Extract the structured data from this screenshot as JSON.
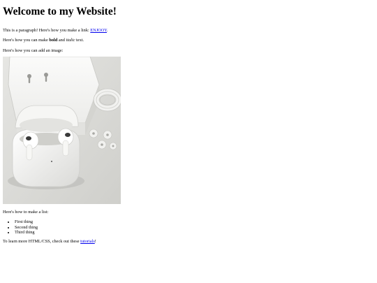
{
  "heading": "Welcome to my Website!",
  "paragraph1": {
    "text": "This is a paragraph! Here's how you make a link: ",
    "link_text": "ENJOOY",
    "suffix": "."
  },
  "paragraph2": {
    "prefix": "Here's how you can make ",
    "bold_text": "bold",
    "middle": " and ",
    "italic_text": "italic",
    "suffix": " text."
  },
  "paragraph3": "Here's how you can add an image:",
  "image": {
    "subject": "white wireless earbuds in open charging case with box, cable and ear tips",
    "colors": {
      "background": "#dcdcd9",
      "case": "#f4f4f2",
      "shadow": "#b9b9b5"
    }
  },
  "paragraph4": "Here's how to make a list:",
  "list_items": [
    "First thing",
    "Second thing",
    "Third thing"
  ],
  "paragraph5": {
    "prefix": "To learn more HTML/CSS, check out these ",
    "link_text": "tutorials",
    "suffix": "!"
  }
}
